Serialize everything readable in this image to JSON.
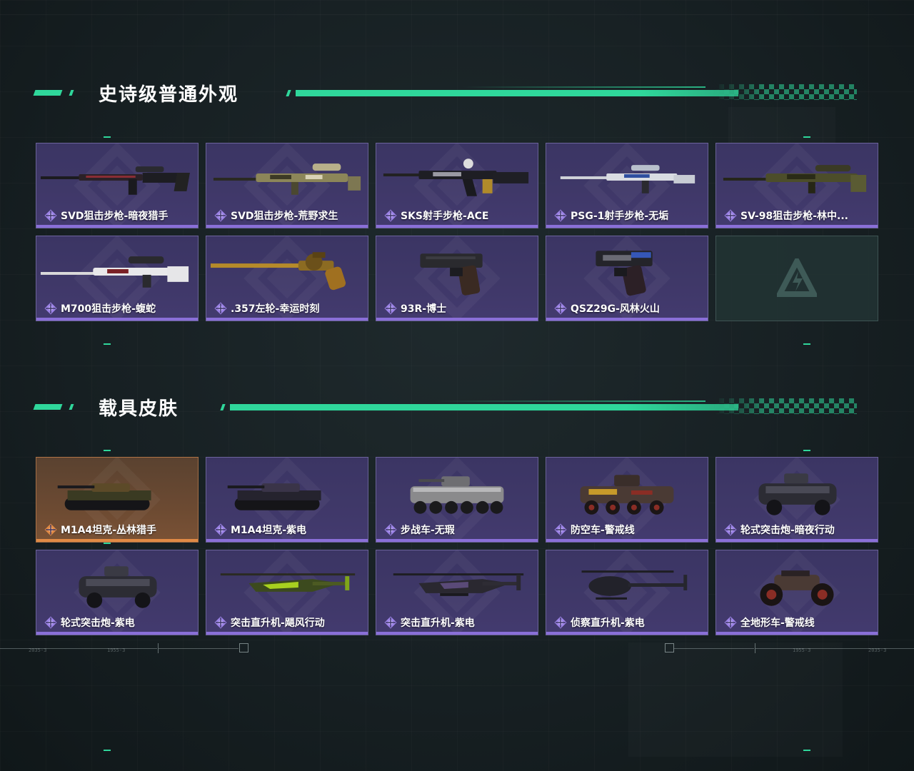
{
  "sections": [
    {
      "title": "史诗级普通外观",
      "items": [
        {
          "label": "SVD狙击步枪-暗夜猎手",
          "icon": "sniper-rifle-icon",
          "rarity": "epic"
        },
        {
          "label": "SVD狙击步枪-荒野求生",
          "icon": "sniper-rifle-camo-icon",
          "rarity": "epic"
        },
        {
          "label": "SKS射手步枪-ACE",
          "icon": "assault-rifle-icon",
          "rarity": "epic"
        },
        {
          "label": "PSG-1射手步枪-无垢",
          "icon": "marksman-rifle-icon",
          "rarity": "epic"
        },
        {
          "label": "SV-98狙击步枪-林中...",
          "icon": "sniper-rifle-woodland-icon",
          "rarity": "epic"
        },
        {
          "label": "M700狙击步枪-蝮蛇",
          "icon": "sniper-rifle-white-icon",
          "rarity": "epic"
        },
        {
          "label": ".357左轮-幸运时刻",
          "icon": "revolver-icon",
          "rarity": "epic"
        },
        {
          "label": "93R-博士",
          "icon": "pistol-icon",
          "rarity": "epic"
        },
        {
          "label": "QSZ29G-风林火山",
          "icon": "pistol-engraved-icon",
          "rarity": "epic"
        },
        {
          "label": "",
          "icon": "game-logo-icon",
          "rarity": "empty"
        }
      ]
    },
    {
      "title": "载具皮肤",
      "items": [
        {
          "label": "M1A4坦克-丛林猎手",
          "icon": "tank-camo-icon",
          "rarity": "legendary"
        },
        {
          "label": "M1A4坦克-紫电",
          "icon": "tank-icon",
          "rarity": "epic"
        },
        {
          "label": "步战车-无瑕",
          "icon": "ifv-icon",
          "rarity": "epic"
        },
        {
          "label": "防空车-警戒线",
          "icon": "aa-vehicle-icon",
          "rarity": "epic"
        },
        {
          "label": "轮式突击炮-暗夜行动",
          "icon": "wheeled-assault-gun-icon",
          "rarity": "epic"
        },
        {
          "label": "轮式突击炮-紫电",
          "icon": "wheeled-assault-gun-icon",
          "rarity": "epic"
        },
        {
          "label": "突击直升机-飓风行动",
          "icon": "attack-helicopter-green-icon",
          "rarity": "epic"
        },
        {
          "label": "突击直升机-紫电",
          "icon": "attack-helicopter-icon",
          "rarity": "epic"
        },
        {
          "label": "侦察直升机-紫电",
          "icon": "scout-helicopter-icon",
          "rarity": "epic"
        },
        {
          "label": "全地形车-警戒线",
          "icon": "atv-icon",
          "rarity": "epic"
        }
      ]
    }
  ],
  "colors": {
    "accent": "#2fd79b",
    "epic_purple": "#8a6fd8",
    "legendary_orange": "#e08a45",
    "card_bg": "#3f3868"
  },
  "hud": {
    "left_code_1": "2035-3",
    "left_code_2": "1955-3",
    "right_code_1": "1955-3",
    "right_code_2": "2035-3"
  }
}
